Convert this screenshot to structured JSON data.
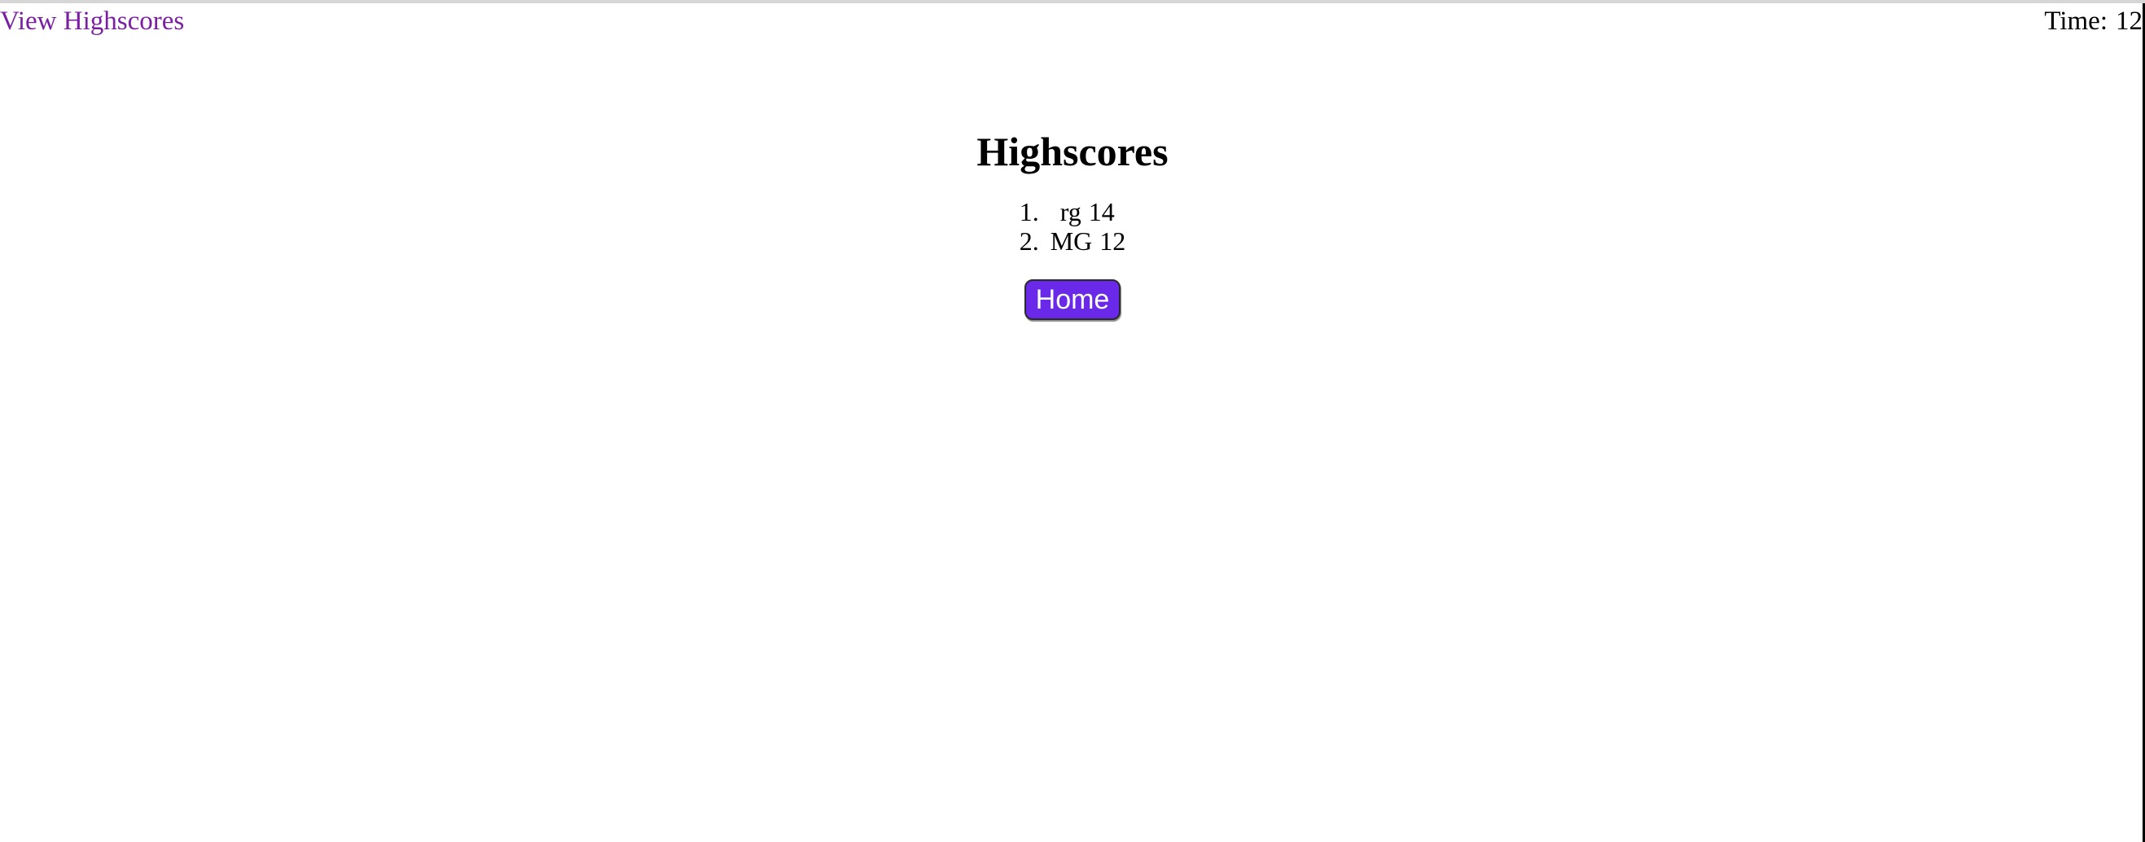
{
  "nav": {
    "highscores_link": "View Highscores",
    "link_color": "#7b1fa2"
  },
  "timer": {
    "label": "Time:",
    "value": "12"
  },
  "main": {
    "title": "Highscores",
    "scores": [
      {
        "rank": "1.",
        "name": "rg",
        "score": "14"
      },
      {
        "rank": "2.",
        "name": "MG",
        "score": "12"
      }
    ],
    "home_button": "Home",
    "button_color": "#6a28e8"
  }
}
